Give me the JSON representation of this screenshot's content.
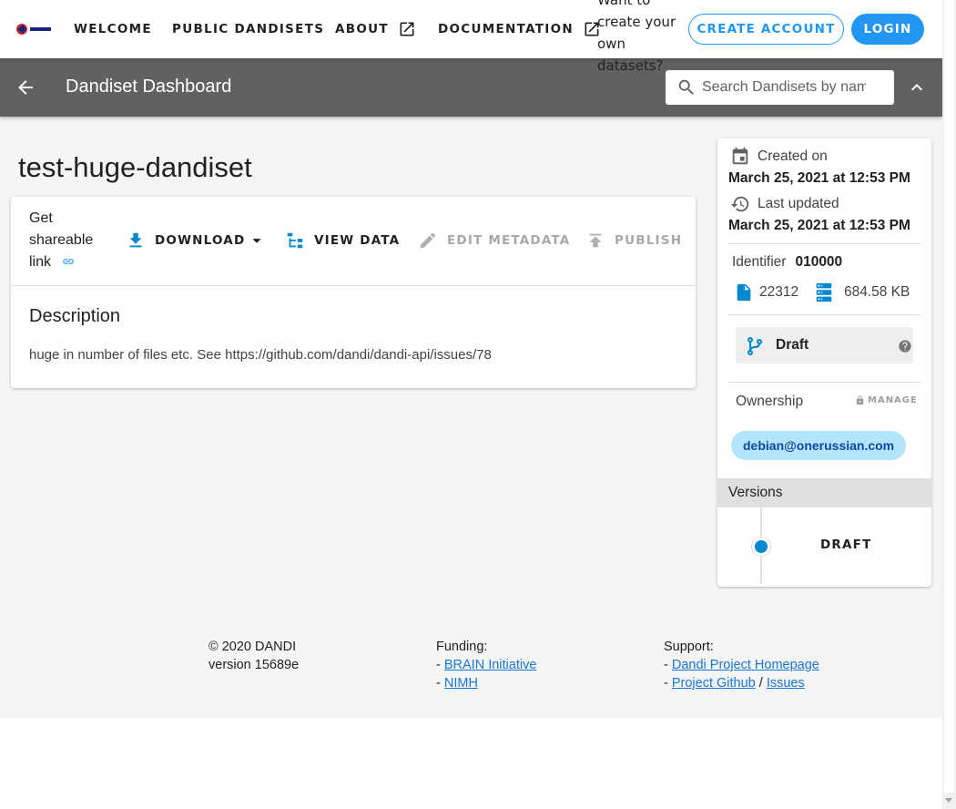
{
  "topbar": {
    "logo_alt": "DANDI",
    "nav": [
      "Welcome",
      "Public Dandisets",
      "About",
      "Documentation"
    ],
    "promo_text": "Want to create your own datasets?",
    "create_account": "Create Account",
    "login": "Login"
  },
  "toolbar": {
    "title": "Dandiset Dashboard",
    "search_placeholder": "Search Dandisets by name, description, identifier, or contributor name"
  },
  "dandiset": {
    "name": "test-huge-dandiset",
    "actions": {
      "share": "Get shareable link",
      "download": "Download",
      "view_data": "View Data",
      "edit_metadata": "Edit Metadata",
      "publish": "Publish"
    },
    "description_heading": "Description",
    "description": "huge in number of files etc. See https://github.com/dandi/dandi-api/issues/78"
  },
  "sidebar": {
    "created_label": "Created on",
    "created_value": "March 25, 2021 at 12:53 PM",
    "updated_label": "Last updated",
    "updated_value": "March 25, 2021 at 12:53 PM",
    "identifier_label": "Identifier",
    "identifier_value": "010000",
    "file_count": "22312",
    "size": "684.58 KB",
    "version_label": "Draft",
    "ownership_label": "Ownership",
    "manage_label": "MANAGE",
    "owner": "debian@onerussian.com",
    "versions_heading": "Versions",
    "versions": [
      "DRAFT"
    ]
  },
  "footer": {
    "copyright": "© 2020 DANDI",
    "version": "version 15689e",
    "funding_label": "Funding:",
    "funding_links": [
      "BRAIN Initiative",
      "NIMH"
    ],
    "support_label": "Support:",
    "support_links": [
      "Dandi Project Homepage",
      "Project Github",
      "Issues"
    ]
  },
  "colors": {
    "primary": "#2196f3",
    "toolbar": "#616161",
    "chip": "#b3e5fc",
    "icon_blue": "#0288d1"
  },
  "icons": [
    "dandi-logo",
    "open-in-new-icon",
    "arrow-left-icon",
    "search-icon",
    "chevron-up-icon",
    "link-icon",
    "download-icon",
    "caret-down-icon",
    "file-tree-icon",
    "pencil-icon",
    "upload-icon",
    "calendar-icon",
    "history-icon",
    "file-icon",
    "database-icon",
    "source-branch-icon",
    "help-circle-icon",
    "lock-icon"
  ]
}
